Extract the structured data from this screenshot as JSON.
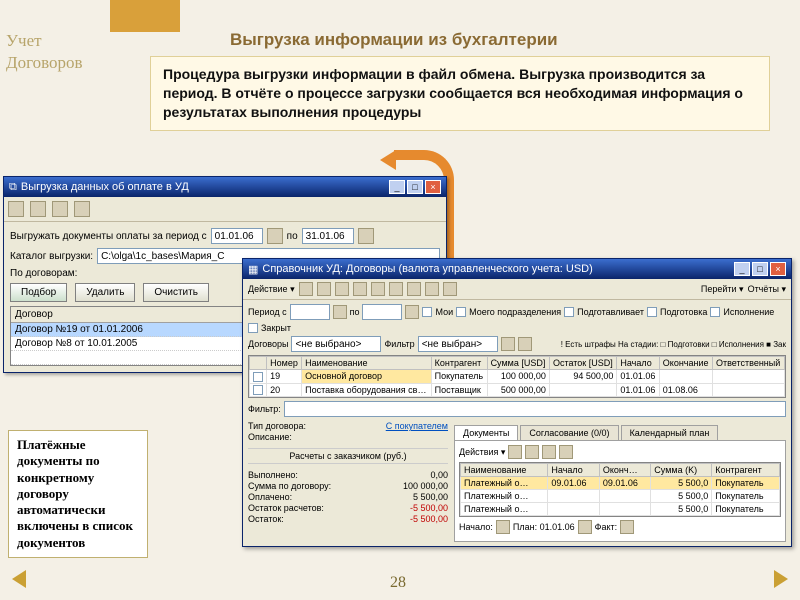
{
  "slide": {
    "side_title_l1": "Учет",
    "side_title_l2": "Договоров",
    "main_title": "Выгрузка информации из бухгалтерии",
    "description": "Процедура выгрузки информации в файл обмена. Выгрузка производится за период. В отчёте о процессе загрузки сообщается вся необходимая информация о результатах выполнения процедуры",
    "note": "Платёжные документы по конкретному договору автоматически включены в список документов",
    "page": "28"
  },
  "win1": {
    "title": "Выгрузка данных об оплате в УД",
    "period_label": "Выгружать документы оплаты за период с",
    "date_from": "01.01.06",
    "date_to_lbl": "по",
    "date_to": "31.01.06",
    "catalog_label": "Каталог выгрузки:",
    "catalog_value": "C:\\olga\\1c_bases\\Мария_С",
    "by_contracts": "По договорам:",
    "btn_select": "Подбор",
    "btn_delete": "Удалить",
    "btn_clear": "Очистить",
    "grid_head": "Договор",
    "rows": [
      "Договор №19 от 01.01.2006",
      "Договор №8 от 10.01.2005"
    ]
  },
  "win2": {
    "title": "Справочник УД: Договоры (валюта управленческого учета: USD)",
    "action_lbl": "Действие ▾",
    "goto": "Перейти ▾",
    "reports": "Отчёты ▾",
    "period_lbl": "Период с",
    "period_to": "по",
    "chk_my": "Мои",
    "chk_dept": "Моего подразделения",
    "chk_prep": "Подготавливает",
    "chk_ready": "Подготовка",
    "chk_exec": "Исполнение",
    "chk_closed": "Закрыт",
    "contracts_lbl": "Договоры",
    "none": "<не выбрано>",
    "filter_lbl": "Фильтр",
    "filter_none": "<не выбран>",
    "legend": "! Есть штрафы  На стадии: □ Подготовки □ Исполнения ■ Зак",
    "cols": [
      "",
      "Номер",
      "Наименование",
      "Контрагент",
      "Сумма [USD]",
      "Остаток [USD]",
      "Начало",
      "Окончание",
      "Ответственный"
    ],
    "data": [
      {
        "num": "19",
        "name": "Основной договор",
        "agent": "Покупатель",
        "sum": "100 000,00",
        "rest": "94 500,00",
        "start": "01.01.06",
        "end": ""
      },
      {
        "num": "20",
        "name": "Поставка оборудования св…",
        "agent": "Поставщик",
        "sum": "500 000,00",
        "rest": "",
        "start": "01.01.06",
        "end": "01.08.06"
      }
    ],
    "filter2": "Фильтр:",
    "tabs": [
      "Документы",
      "Согласование (0/0)",
      "Календарный план"
    ],
    "actions2": "Действия ▾",
    "type_lbl": "Тип договора:",
    "type_val": "С покупателем",
    "desc_lbl": "Описание:",
    "calc_title": "Расчеты с заказчиком (руб.)",
    "kv": [
      {
        "l": "Выполнено:",
        "v": "0,00"
      },
      {
        "l": "Сумма по договору:",
        "v": "100 000,00"
      },
      {
        "l": "Оплачено:",
        "v": "5 500,00"
      },
      {
        "l": "Остаток расчетов:",
        "v": "-5 500,00"
      },
      {
        "l": "Остаток:",
        "v": "-5 500,00"
      }
    ],
    "doc_cols": [
      "Наименование",
      "Начало",
      "Оконч…",
      "Сумма (K)",
      "Контрагент"
    ],
    "docs": [
      {
        "n": "Платежный о…",
        "s": "09.01.06",
        "e": "09.01.06",
        "sum": "5 500,0",
        "a": "Покупатель"
      },
      {
        "n": "Платежный о…",
        "s": "",
        "e": "",
        "sum": "5 500,0",
        "a": "Покупатель"
      },
      {
        "n": "Платежный о…",
        "s": "",
        "e": "",
        "sum": "5 500,0",
        "a": "Покупатель"
      }
    ],
    "footer_start": "Начало:",
    "footer_plan": "План: 01.01.06",
    "footer_fact": "Факт:"
  }
}
